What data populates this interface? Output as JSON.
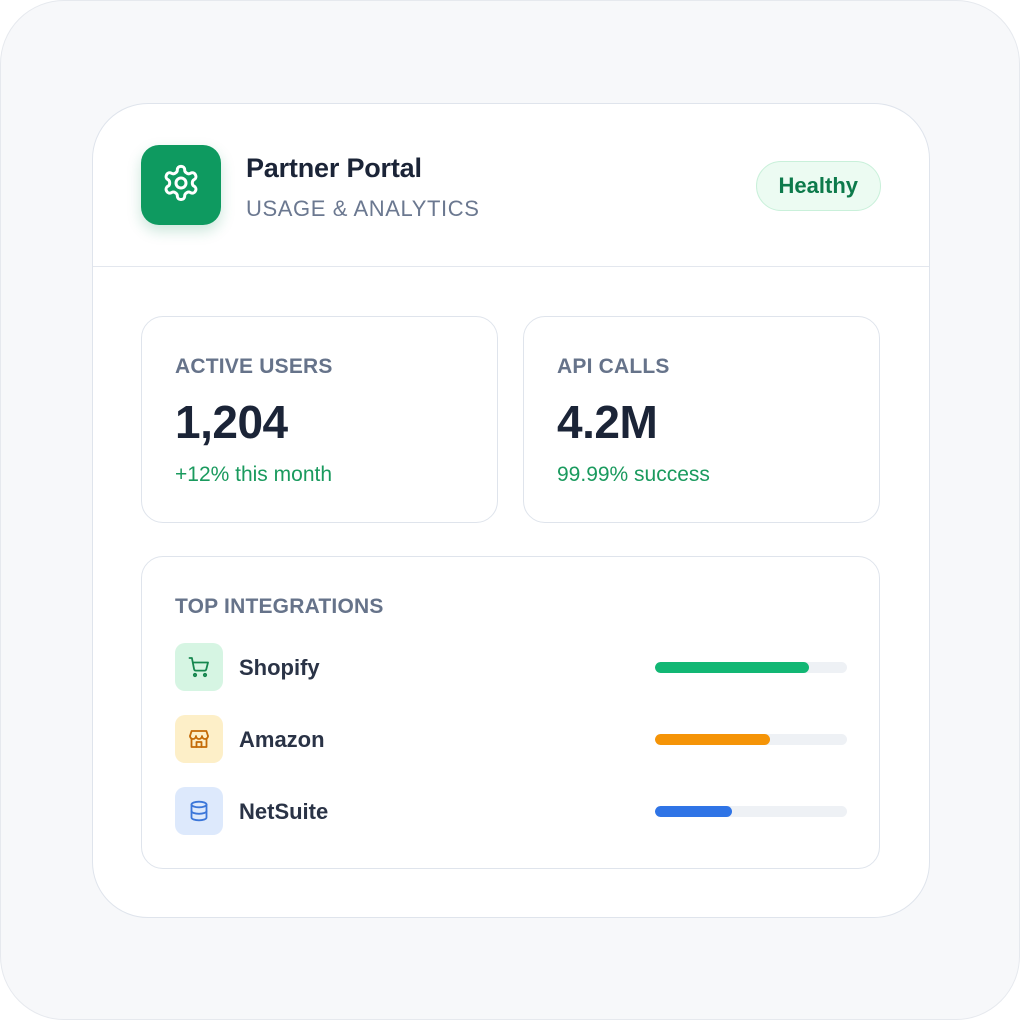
{
  "header": {
    "title": "Partner Portal",
    "subtitle": "USAGE & ANALYTICS",
    "icon": "gear-icon",
    "icon_bg": "#0e9a60",
    "status": {
      "label": "Healthy",
      "color": "#0d7a4b",
      "bg": "#ecfbf2"
    }
  },
  "stats": [
    {
      "label": "ACTIVE USERS",
      "value": "1,204",
      "note": "+12% this month",
      "note_color": "#1a9a5e"
    },
    {
      "label": "API CALLS",
      "value": "4.2M",
      "note": "99.99% success",
      "note_color": "#1a9a5e"
    }
  ],
  "integrations": {
    "heading": "TOP INTEGRATIONS",
    "items": [
      {
        "name": "Shopify",
        "icon": "cart-icon",
        "icon_color": "#16874f",
        "icon_bg": "#d6f5e3",
        "bar_color": "#12b774",
        "share": 0.8
      },
      {
        "name": "Amazon",
        "icon": "storefront-icon",
        "icon_color": "#c46a06",
        "icon_bg": "#fdefc8",
        "bar_color": "#f59407",
        "share": 0.6
      },
      {
        "name": "NetSuite",
        "icon": "database-icon",
        "icon_color": "#3b76d9",
        "icon_bg": "#dde9fc",
        "bar_color": "#2f74e6",
        "share": 0.4
      }
    ]
  }
}
